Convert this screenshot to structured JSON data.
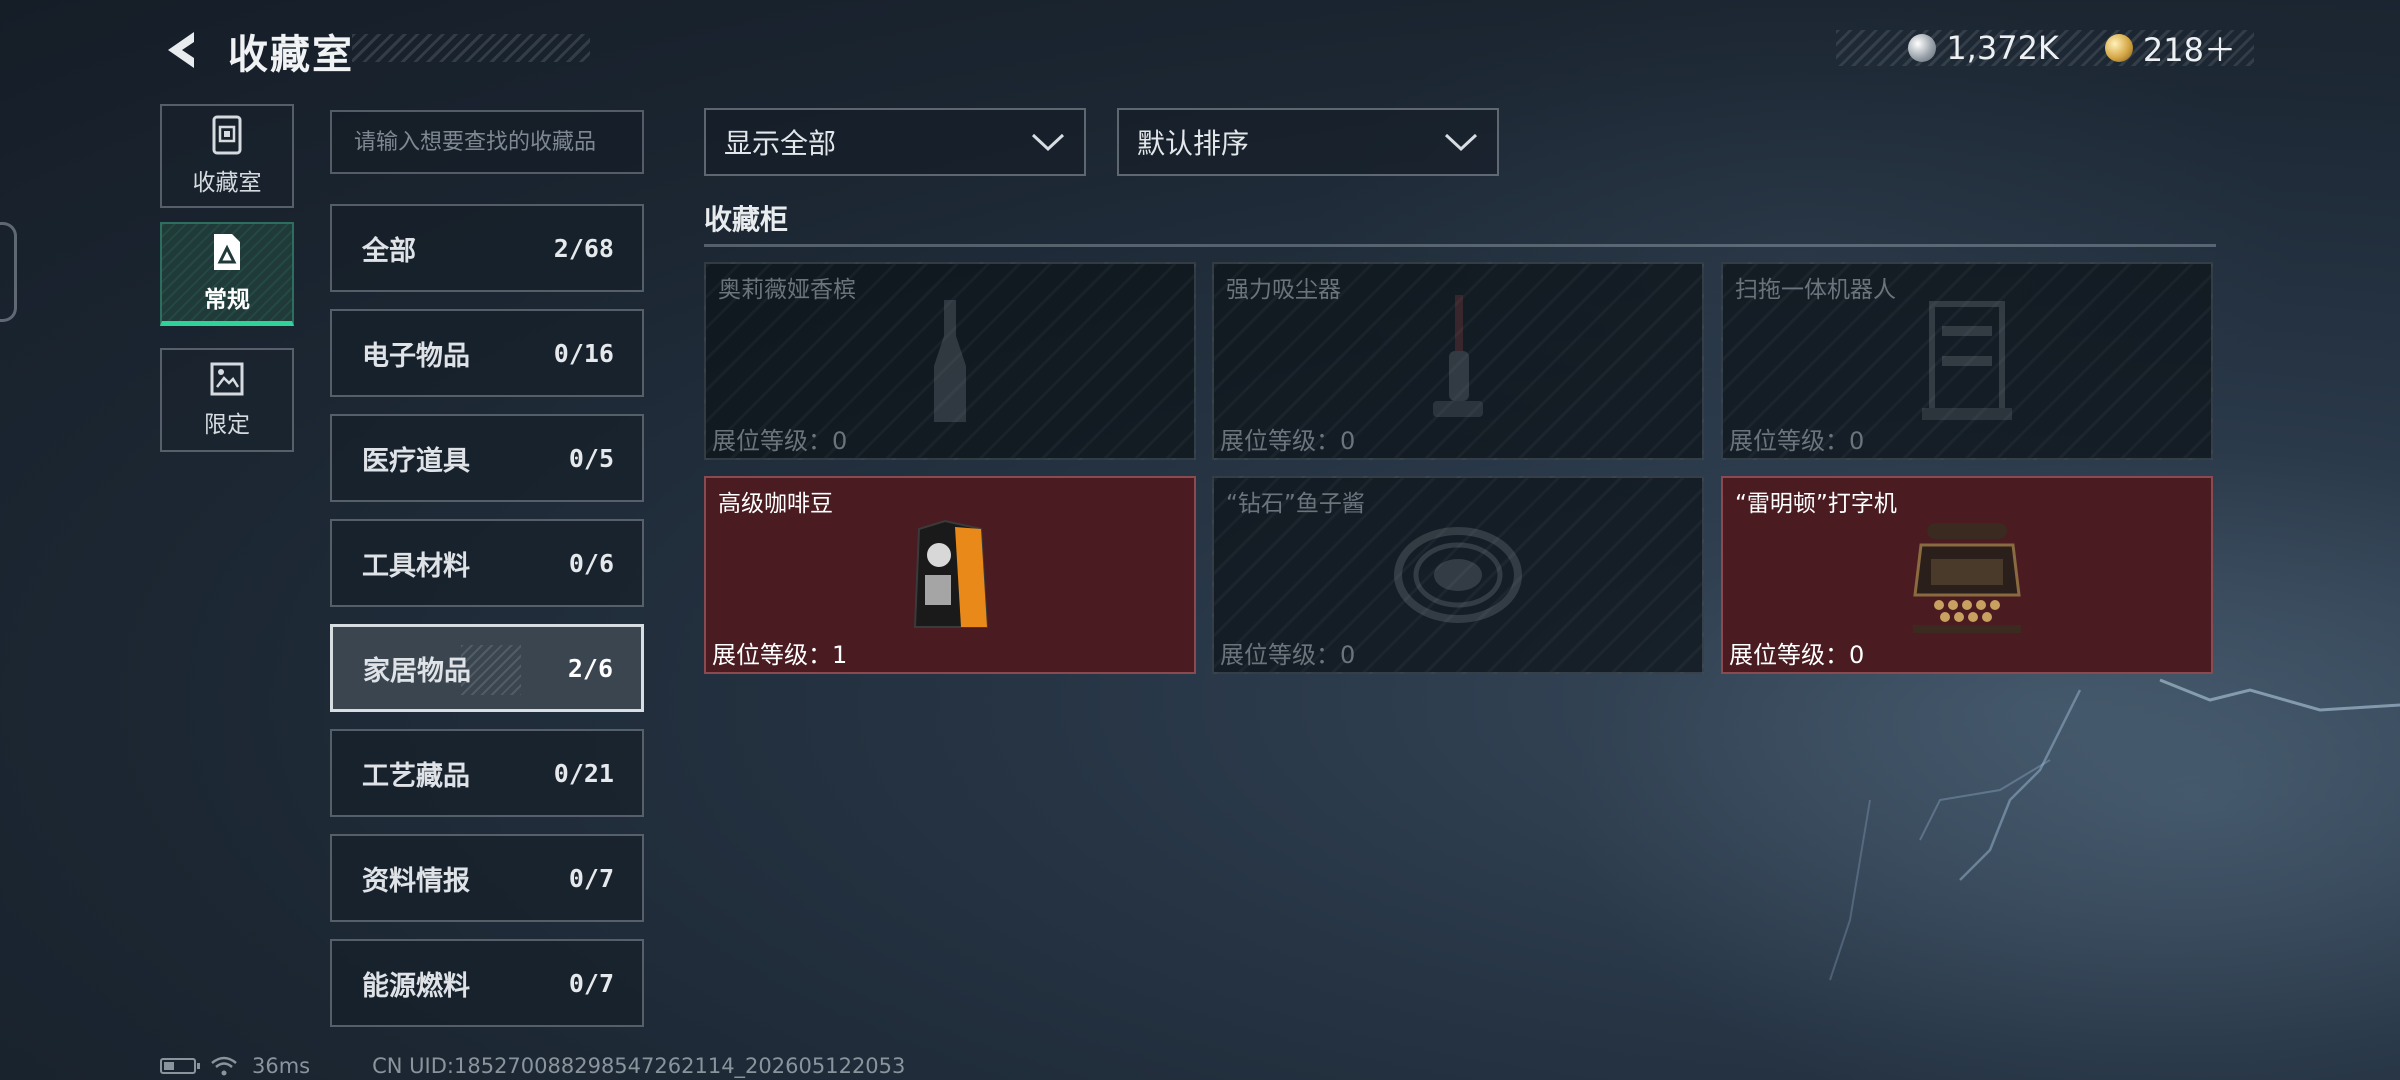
{
  "header": {
    "title": "收藏室",
    "currency": [
      {
        "icon": "silver-coin-icon",
        "value": "1,372K"
      },
      {
        "icon": "gold-coin-icon",
        "value": "218＋"
      }
    ]
  },
  "nav": {
    "items": [
      {
        "label": "收藏室",
        "icon": "trash-bin-icon"
      },
      {
        "label": "常规",
        "icon": "document-icon",
        "active": true
      },
      {
        "label": "限定",
        "icon": "picture-icon"
      }
    ]
  },
  "search": {
    "placeholder": "请输入想要查找的收藏品"
  },
  "categories": [
    {
      "name": "全部",
      "count": "2/68"
    },
    {
      "name": "电子物品",
      "count": "0/16"
    },
    {
      "name": "医疗道具",
      "count": "0/5"
    },
    {
      "name": "工具材料",
      "count": "0/6"
    },
    {
      "name": "家居物品",
      "count": "2/6",
      "active": true
    },
    {
      "name": "工艺藏品",
      "count": "0/21"
    },
    {
      "name": "资料情报",
      "count": "0/7"
    },
    {
      "name": "能源燃料",
      "count": "0/7"
    }
  ],
  "filters": {
    "filter": "显示全部",
    "sort": "默认排序"
  },
  "cabinet": {
    "title": "收藏柜",
    "level_label": "展位等级：",
    "items": [
      {
        "name": "奥莉薇娅香槟",
        "level": "0",
        "owned": false,
        "icon": "champagne-bottle-icon"
      },
      {
        "name": "强力吸尘器",
        "level": "0",
        "owned": false,
        "icon": "vacuum-cleaner-icon"
      },
      {
        "name": "扫拖一体机器人",
        "level": "0",
        "owned": false,
        "icon": "robot-station-icon"
      },
      {
        "name": "高级咖啡豆",
        "level": "1",
        "owned": true,
        "icon": "coffee-bag-icon"
      },
      {
        "name": "“钻石”鱼子酱",
        "level": "0",
        "owned": false,
        "icon": "caviar-tin-icon"
      },
      {
        "name": "“雷明顿”打字机",
        "level": "0",
        "owned": true,
        "icon": "typewriter-icon"
      }
    ]
  },
  "footer": {
    "ping": "36ms",
    "uid": "CN UID:18527008829854726​2114_202605122053"
  },
  "colors": {
    "accent": "#2fd39a",
    "owned_card": "#4a1b20",
    "background": "#1c2733"
  }
}
